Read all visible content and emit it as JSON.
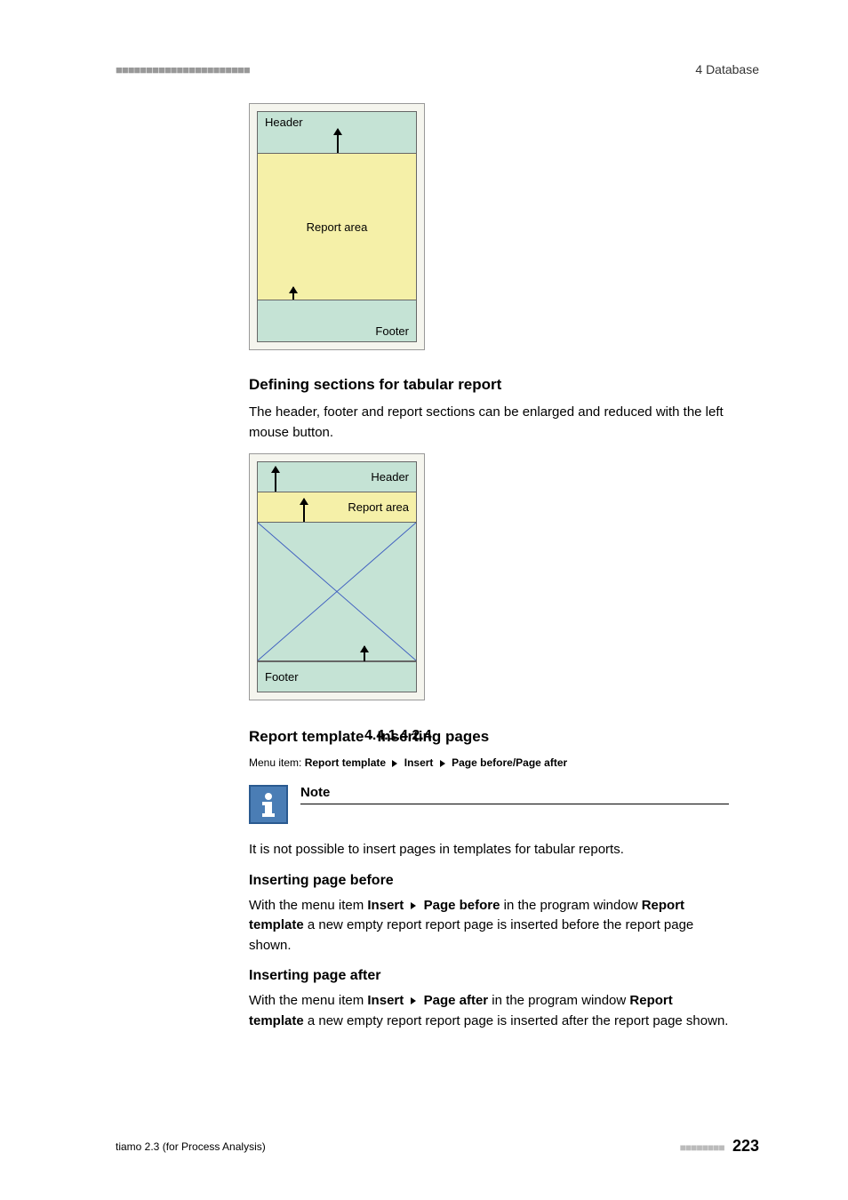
{
  "header": {
    "dashes": "■■■■■■■■■■■■■■■■■■■■■■",
    "chapter": "4 Database"
  },
  "diagram1": {
    "header": "Header",
    "body": "Report area",
    "footer": "Footer"
  },
  "sec1_heading": "Defining sections for tabular report",
  "sec1_para": "The header, footer and report sections can be enlarged and reduced with the left mouse button.",
  "diagram2": {
    "header": "Header",
    "report": "Report area",
    "footer": "Footer"
  },
  "section_number": "4.4.1.4.2.4",
  "section_title": "Report template - Inserting pages",
  "menu_path": {
    "prefix": "Menu item: ",
    "part1": "Report template",
    "part2": "Insert",
    "part3": "Page before/Page after"
  },
  "note": {
    "label": "Note",
    "text": "It is not possible to insert pages in templates for tabular reports."
  },
  "before": {
    "heading": "Inserting page before",
    "t1": "With the menu item ",
    "b1": "Insert",
    "b2": "Page before",
    "t2": " in the program window ",
    "b3": "Report template",
    "t3": " a new empty report report page is inserted before the report page shown."
  },
  "after": {
    "heading": "Inserting page after",
    "t1": "With the menu item ",
    "b1": "Insert",
    "b2": "Page after",
    "t2": " in the program window ",
    "b3": "Report template",
    "t3": " a new empty report report page is inserted after the report page shown."
  },
  "footer": {
    "product": "tiamo 2.3 (for Process Analysis)",
    "dashes": "■■■■■■■■",
    "page": "223"
  }
}
